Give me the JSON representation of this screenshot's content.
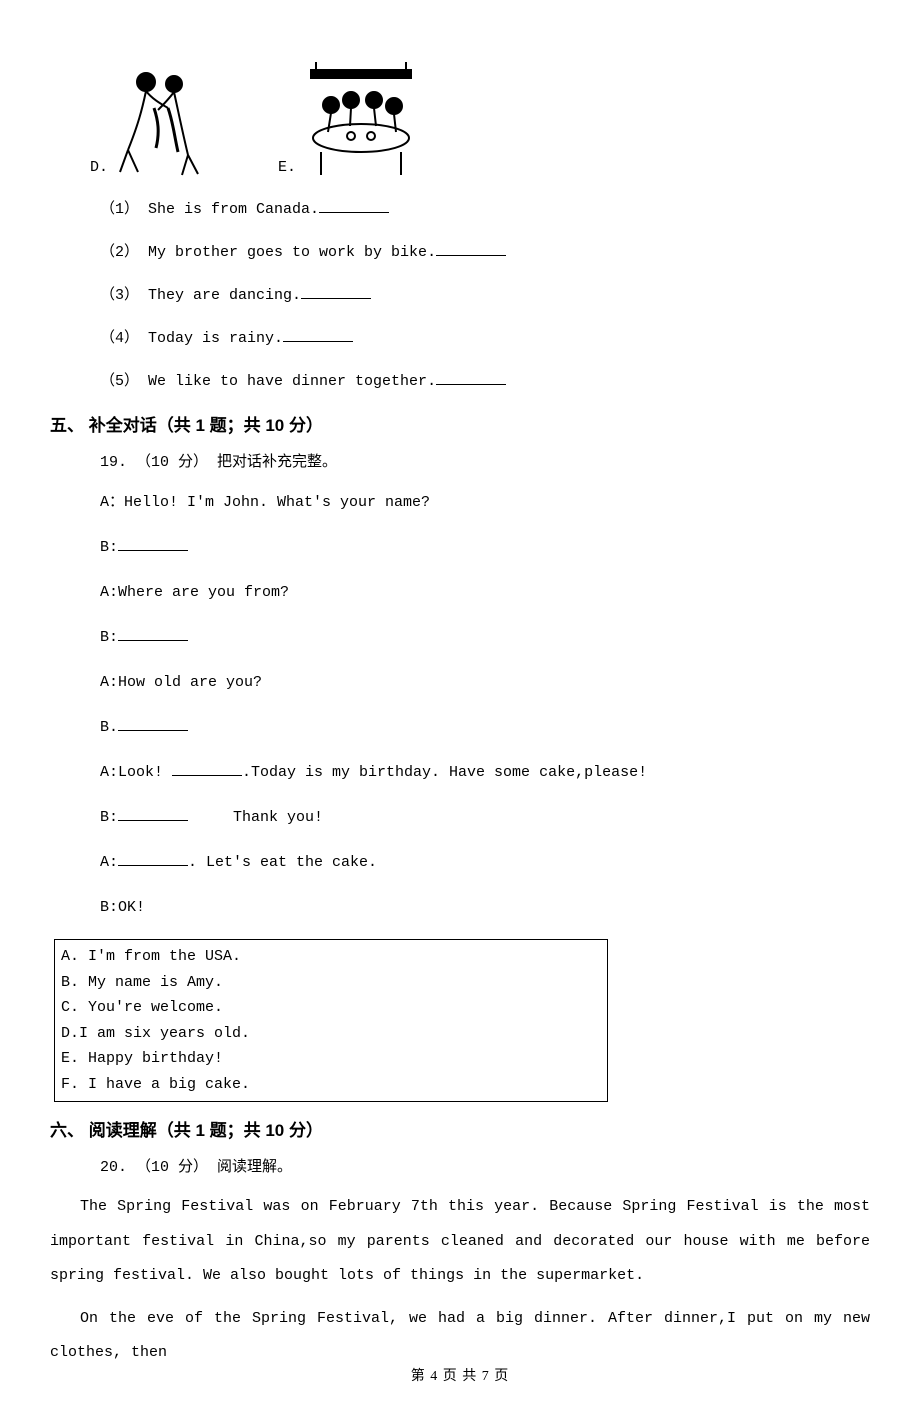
{
  "images": {
    "d_label": "D.",
    "e_label": "E."
  },
  "matching": {
    "items": [
      {
        "num": "（1）",
        "text": " She is from Canada."
      },
      {
        "num": "（2）",
        "text": " My brother goes to work by bike."
      },
      {
        "num": "（3）",
        "text": " They are dancing."
      },
      {
        "num": "（4）",
        "text": " Today is rainy."
      },
      {
        "num": "（5）",
        "text": " We like to have dinner together."
      }
    ]
  },
  "section5": {
    "heading": "五、 补全对话（共 1 题；共 10 分）",
    "intro": "19. （10 分） 把对话补充完整。",
    "lines": {
      "a1": "A：Hello! I'm John. What's your name?",
      "b1": "B:",
      "a2": "A:Where are you from?",
      "b2": "B:",
      "a3": "A:How old are you?",
      "b3": "B.",
      "a4a": "A:Look! ",
      "a4b": ".Today is my birthday. Have some cake,please!",
      "b4": "B:",
      "b4_tail": "     Thank you!",
      "a5a": "A:",
      "a5b": ". Let's eat the cake.",
      "b5": "B:OK!"
    },
    "options": [
      "A. I'm from the USA.",
      "B. My name is Amy.",
      "C. You're welcome.",
      "D.I am six years old.",
      "E. Happy birthday!",
      "F. I have a big cake."
    ]
  },
  "section6": {
    "heading": "六、 阅读理解（共 1 题；共 10 分）",
    "intro": "20. （10 分） 阅读理解。",
    "para1": "The Spring Festival was on February 7th this year. Because Spring Festival is the most important festival in China,so my parents cleaned and decorated our house with me before spring festival. We also bought lots of things in the supermarket.",
    "para2": "On the eve of the Spring Festival, we had a big dinner. After dinner,I put on my new clothes, then"
  },
  "footer": "第 4 页 共 7 页"
}
